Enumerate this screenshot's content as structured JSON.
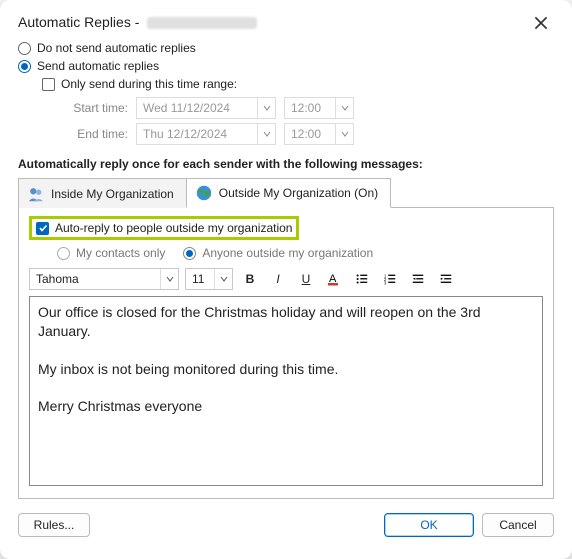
{
  "window": {
    "title_prefix": "Automatic Replies -"
  },
  "radios": {
    "no_send": "Do not send automatic replies",
    "send": "Send automatic replies"
  },
  "only_range": "Only send during this time range:",
  "time": {
    "start_label": "Start time:",
    "start_date": "Wed 11/12/2024",
    "start_time": "12:00",
    "end_label": "End time:",
    "end_date": "Thu 12/12/2024",
    "end_time": "12:00"
  },
  "auto_text": "Automatically reply once for each sender with the following messages:",
  "tabs": {
    "inside": "Inside My Organization",
    "outside": "Outside My Organization (On)"
  },
  "outside": {
    "autoreply_check": "Auto-reply to people outside my organization",
    "contacts_only": "My contacts only",
    "anyone": "Anyone outside my organization"
  },
  "editor": {
    "font": "Tahoma",
    "size": "11",
    "body": "Our office is closed for the Christmas holiday and will reopen on the 3rd January.\n\nMy inbox is not being monitored during this time.\n\nMerry Christmas everyone"
  },
  "buttons": {
    "rules": "Rules...",
    "ok": "OK",
    "cancel": "Cancel"
  }
}
